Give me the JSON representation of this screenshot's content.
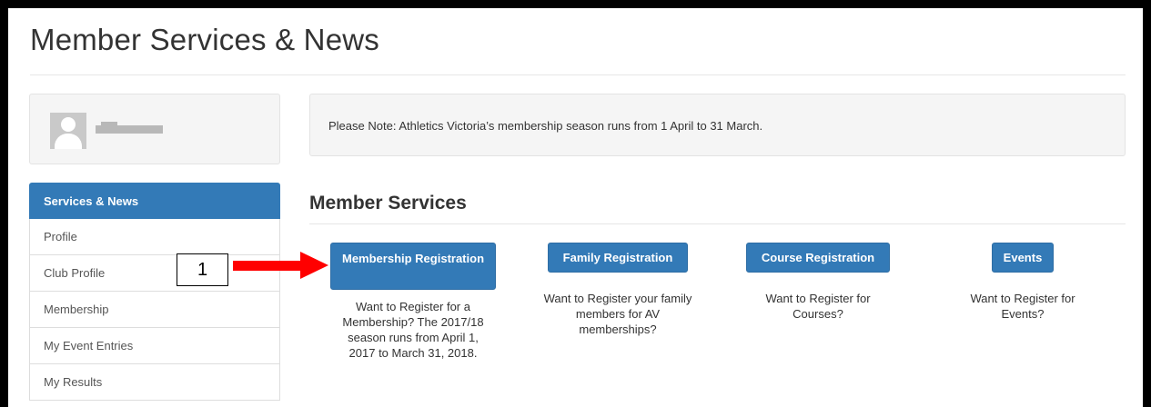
{
  "page": {
    "title": "Member Services & News"
  },
  "profile": {
    "avatar_icon": "user-silhouette-icon",
    "name_redacted": true
  },
  "sidebar": {
    "items": [
      {
        "label": "Services & News",
        "active": true
      },
      {
        "label": "Profile"
      },
      {
        "label": "Club Profile"
      },
      {
        "label": "Membership"
      },
      {
        "label": "My Event Entries"
      },
      {
        "label": "My Results"
      }
    ]
  },
  "notice": {
    "text": "Please Note: Athletics Victoria’s membership season runs from 1 April to 31 March."
  },
  "member_services": {
    "title": "Member Services",
    "cards": [
      {
        "button": "Membership Registration",
        "description": "Want to Register for a Membership? The 2017/18 season runs from April 1, 2017 to March 31, 2018."
      },
      {
        "button": "Family Registration",
        "description": "Want to Register your family members for AV memberships?"
      },
      {
        "button": "Course Registration",
        "description": "Want to Register for Courses?"
      },
      {
        "button": "Events",
        "description": "Want to Register for Events?"
      }
    ]
  },
  "annotation": {
    "callout_number": "1",
    "arrow_color": "#ff0000"
  },
  "colors": {
    "primary": "#337ab7",
    "panel": "#f5f5f5"
  }
}
